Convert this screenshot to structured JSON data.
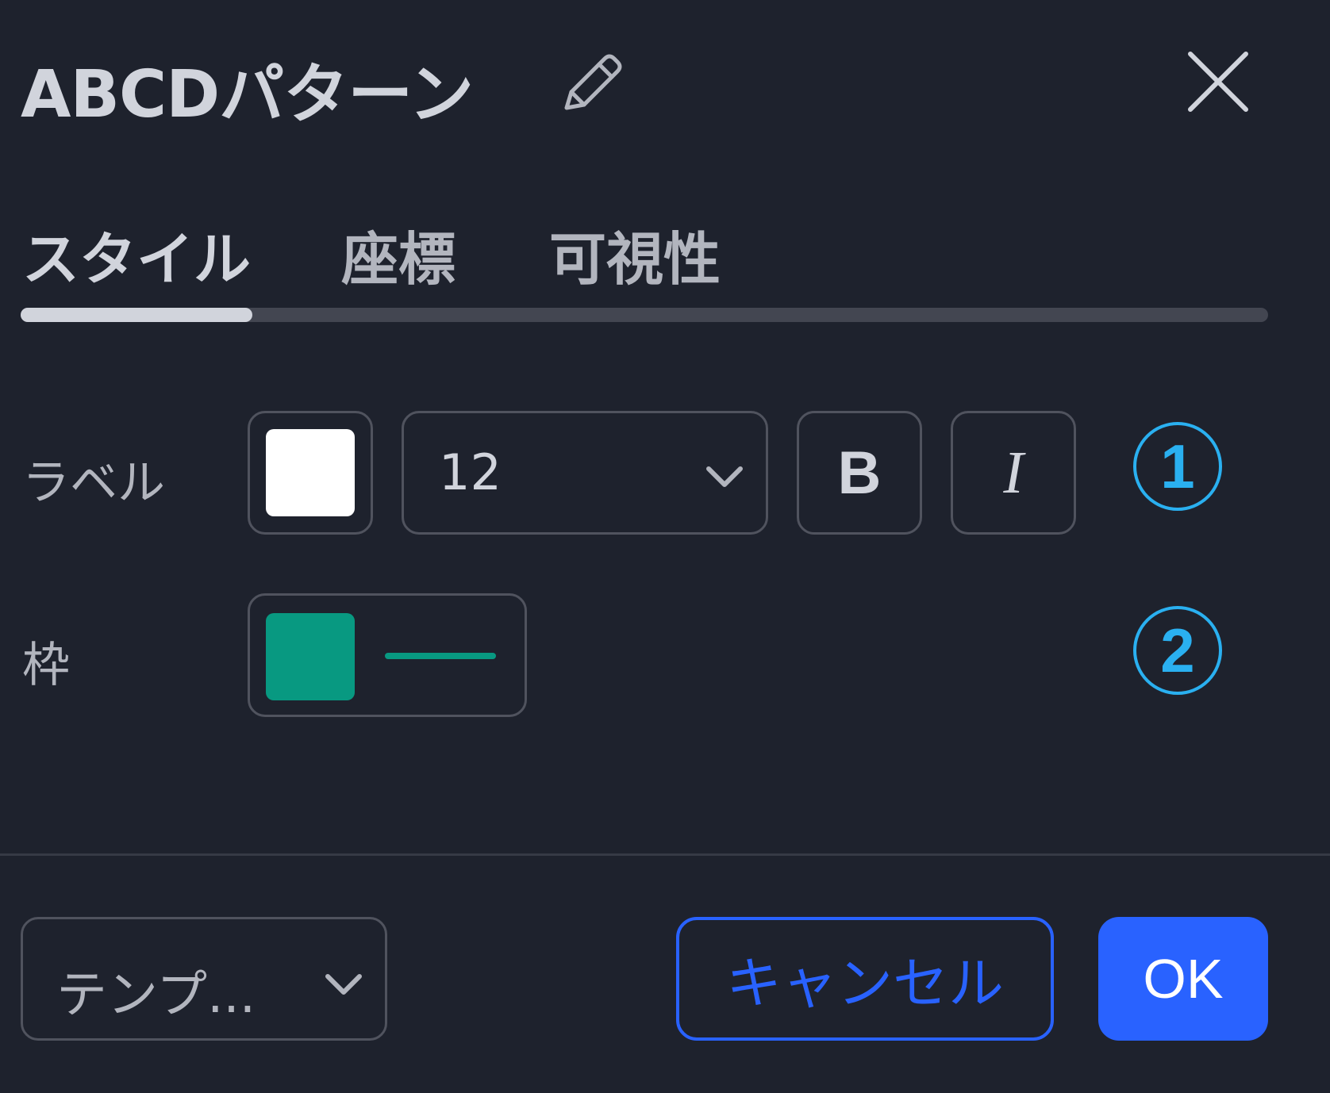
{
  "header": {
    "title": "ABCDパターン",
    "edit_icon": "pencil-icon",
    "close_icon": "close-icon"
  },
  "tabs": [
    {
      "label": "スタイル",
      "active": true
    },
    {
      "label": "座標",
      "active": false
    },
    {
      "label": "可視性",
      "active": false
    }
  ],
  "label_row": {
    "label": "ラベル",
    "color": "#ffffff",
    "font_size": "12",
    "bold_label": "B",
    "italic_label": "I",
    "annotation": "1"
  },
  "border_row": {
    "label": "枠",
    "color": "#089981",
    "annotation": "2"
  },
  "footer": {
    "template_label": "テンプ...",
    "cancel_label": "キャンセル",
    "ok_label": "OK"
  },
  "colors": {
    "background": "#1e222d",
    "accent": "#2962ff",
    "annotation": "#2ab0f0"
  }
}
